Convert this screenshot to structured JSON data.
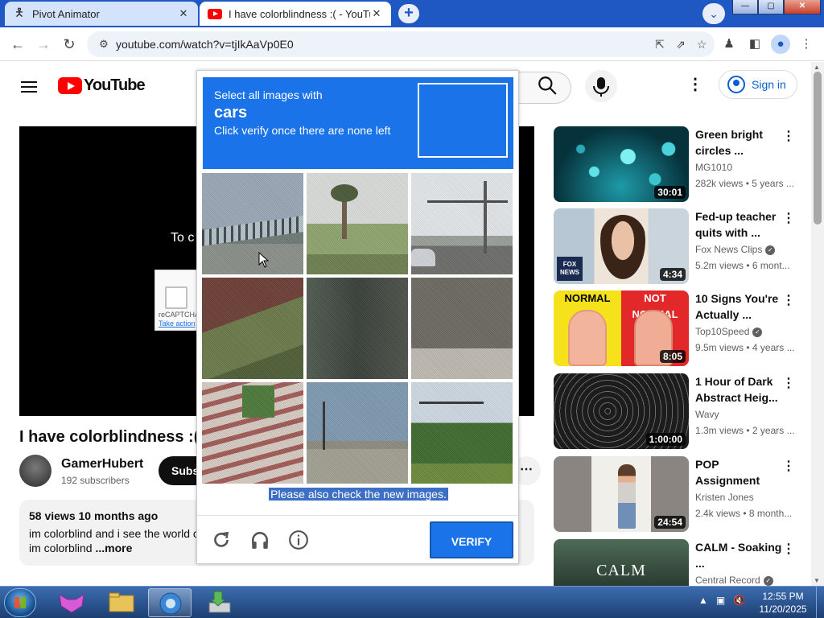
{
  "browser": {
    "tabs": [
      {
        "title": "Pivot Animator",
        "close": "✕"
      },
      {
        "title": "I have colorblindness :( - YouTube",
        "close": "✕"
      }
    ],
    "new_tab": "+",
    "window_buttons": {
      "minimize": "—",
      "maximize": "▢",
      "close": "✕"
    },
    "url": "youtube.com/watch?v=tjIkAaVp0E0"
  },
  "youtube": {
    "logo_text": "YouTube",
    "sign_in": "Sign in",
    "player_message": "To c",
    "recaptcha_mini": {
      "label": "reCAPTCHA",
      "action": "Take action"
    },
    "video_title": "I have colorblindness :(",
    "channel": {
      "name": "GamerHubert",
      "subscribers": "192 subscribers"
    },
    "subscribe_label": "Subs",
    "description": {
      "meta": "58 views  10 months ago",
      "line1": "im colorblind and i see the world c",
      "line2": "im colorblind",
      "more": " ...more"
    }
  },
  "recommendations": [
    {
      "title": "Green bright circles ...",
      "channel": "MG1010",
      "verified": false,
      "stats": "282k views • 5 years ...",
      "duration": "30:01"
    },
    {
      "title": "Fed-up teacher quits with ...",
      "channel": "Fox News Clips",
      "verified": true,
      "stats": "5.2m views • 6 mont...",
      "duration": "4:34",
      "thumb_badge": "FOX NEWS"
    },
    {
      "title": "10 Signs You're Actually ...",
      "channel": "Top10Speed",
      "verified": true,
      "stats": "9.5m views • 4 years ...",
      "duration": "8:05",
      "thumb_labels": [
        "NORMAL",
        "NOT NORMAL"
      ]
    },
    {
      "title": "1 Hour of Dark Abstract Heig...",
      "channel": "Wavy",
      "verified": false,
      "stats": "1.3m views • 2 years ...",
      "duration": "1:00:00"
    },
    {
      "title": "POP Assignment",
      "channel": "Kristen Jones",
      "verified": false,
      "stats": "2.4k views • 8 month...",
      "duration": "24:54"
    },
    {
      "title": "CALM - Soaking ...",
      "channel": "Central Record",
      "verified": true,
      "stats": "",
      "duration": "",
      "thumb_text": "CALM"
    }
  ],
  "captcha": {
    "instruction_line1": "Select all images with",
    "target": "cars",
    "instruction_line2": "Click verify once there are none left",
    "message": "Please also check the new images.",
    "verify_label": "VERIFY",
    "icons": [
      "reload-icon",
      "audio-icon",
      "info-icon"
    ]
  },
  "taskbar": {
    "time": "12:55 PM",
    "date": "11/20/2025"
  },
  "colors": {
    "captcha_blue": "#1a73e8",
    "youtube_red": "#ff0000",
    "chrome_tabbar": "#1f57c3",
    "signin_blue": "#065fd4"
  }
}
